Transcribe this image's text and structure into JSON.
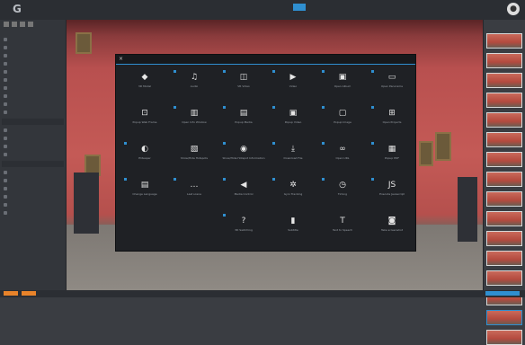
{
  "topbar": {
    "logo": "G",
    "tabs": [
      "",
      "",
      "",
      "",
      "",
      "",
      "",
      "",
      ""
    ],
    "active_tab_index": 6,
    "profile_icon": "user-avatar-icon"
  },
  "modal": {
    "close_label": "×",
    "buttons": [
      {
        "label": "Open Panorama",
        "icon": "panorama-icon",
        "selected": true
      },
      {
        "label": "Open Album",
        "icon": "album-icon",
        "selected": true
      },
      {
        "label": "Video",
        "icon": "video-icon",
        "selected": true
      },
      {
        "label": "VR Video",
        "icon": "vr-video-icon",
        "selected": true
      },
      {
        "label": "Audio",
        "icon": "headphones-icon",
        "selected": true
      },
      {
        "label": "3D Model",
        "icon": "cube-icon",
        "selected": false
      },
      {
        "label": "Open Projects",
        "icon": "projects-icon",
        "selected": true
      },
      {
        "label": "Popup Image",
        "icon": "image-icon",
        "selected": true
      },
      {
        "label": "Popup Video",
        "icon": "popup-video-icon",
        "selected": true
      },
      {
        "label": "Popup Media",
        "icon": "popup-media-icon",
        "selected": true
      },
      {
        "label": "Open Info Window",
        "icon": "info-window-icon",
        "selected": true
      },
      {
        "label": "Popup Web Frame",
        "icon": "web-frame-icon",
        "selected": false
      },
      {
        "label": "Popup PDF",
        "icon": "pdf-icon",
        "selected": true
      },
      {
        "label": "Open URL",
        "icon": "link-icon",
        "selected": true
      },
      {
        "label": "Download File",
        "icon": "download-icon",
        "selected": true
      },
      {
        "label": "Show/Hide Hotspot Information",
        "icon": "eye-icon",
        "selected": true
      },
      {
        "label": "Show/Hide Hotspots",
        "icon": "hotspot-icon",
        "selected": false
      },
      {
        "label": "Eliteaper",
        "icon": "toggle-icon",
        "selected": true
      },
      {
        "label": "Execute Javascript",
        "icon": "javascript-icon",
        "selected": true
      },
      {
        "label": "Timing",
        "icon": "timer-icon",
        "selected": true
      },
      {
        "label": "Gyro Tracking",
        "icon": "gyro-icon",
        "selected": true
      },
      {
        "label": "Media Control",
        "icon": "play-icon",
        "selected": true
      },
      {
        "label": "Last scene",
        "icon": "more-icon",
        "selected": true
      },
      {
        "label": "Change Language",
        "icon": "language-icon",
        "selected": true
      },
      {
        "label": "Take screenshot",
        "icon": "camera-icon",
        "selected": false
      },
      {
        "label": "Text to Speech",
        "icon": "speech-icon",
        "selected": false
      },
      {
        "label": "Subtitle",
        "icon": "subtitle-icon",
        "selected": false
      },
      {
        "label": "3D Switching",
        "icon": "help-icon",
        "selected": true
      }
    ]
  },
  "leftpanel": {
    "rows": [
      "",
      "",
      "",
      "",
      "",
      "",
      "",
      "",
      "",
      "",
      "",
      "",
      "",
      "",
      "",
      "",
      "",
      "",
      ""
    ],
    "sections": [
      "",
      ""
    ]
  },
  "rightpanel": {
    "header": "",
    "thumbnails": 16,
    "selected_index": 14
  },
  "bottombar": {
    "btn1": "",
    "btn2": "",
    "btn3": ""
  },
  "colors": {
    "accent": "#2f8fd0",
    "orange": "#e8832a",
    "wall": "#c45a56",
    "modal_bg": "#1f2125"
  }
}
